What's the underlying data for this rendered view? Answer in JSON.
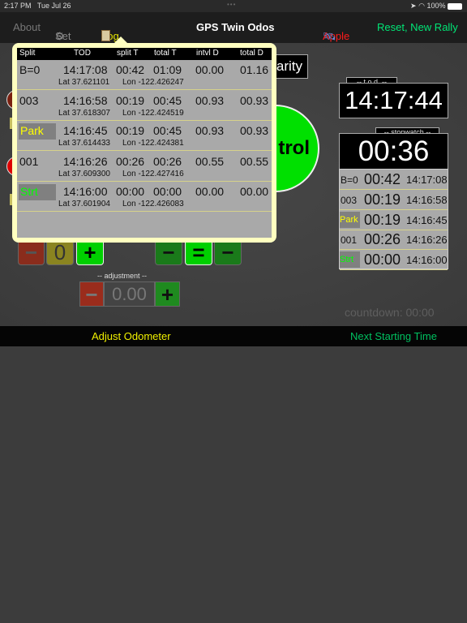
{
  "status_bar": {
    "time": "2:17 PM",
    "date": "Tue Jul 26",
    "battery": "100%"
  },
  "nav": {
    "about": "About",
    "settings": "Set",
    "log": "Log",
    "title": "GPS Twin Odos",
    "apple": "Apple",
    "reset": "Reset, New Rally"
  },
  "colors": {
    "log": "#e6e600",
    "apple": "#ff1a1a",
    "reset": "#00e676",
    "popover": "#ffffc0",
    "green_button": "#00e000"
  },
  "background": {
    "regularity_partial": "arity",
    "control_partial": "trol",
    "zero_button": "0",
    "adjustment_label": "-- adjustment --",
    "adjustment_value": "0.00",
    "minus": "−",
    "plus": "+",
    "equals": "="
  },
  "log": {
    "headers": [
      "Split",
      "TOD",
      "split T",
      "total T",
      "intvl D",
      "total D"
    ],
    "rows": [
      {
        "split": "B=0",
        "tod": "14:17:08",
        "split_t": "00:42",
        "total_t": "01:09",
        "intvl_d": "00.00",
        "total_d": "01.16",
        "lat": "Lat  37.621101",
        "lon": "Lon  -122.426247",
        "tag": ""
      },
      {
        "split": "003",
        "tod": "14:16:58",
        "split_t": "00:19",
        "total_t": "00:45",
        "intvl_d": "00.93",
        "total_d": "00.93",
        "lat": "Lat  37.618307",
        "lon": "Lon  -122.424519",
        "tag": ""
      },
      {
        "split": "Park",
        "tod": "14:16:45",
        "split_t": "00:19",
        "total_t": "00:45",
        "intvl_d": "00.93",
        "total_d": "00.93",
        "lat": "Lat  37.614433",
        "lon": "Lon  -122.424381",
        "tag": "#ffff00"
      },
      {
        "split": "001",
        "tod": "14:16:26",
        "split_t": "00:26",
        "total_t": "00:26",
        "intvl_d": "00.55",
        "total_d": "00.55",
        "lat": "Lat  37.609300",
        "lon": "Lon  -122.427416",
        "tag": ""
      },
      {
        "split": "Strt",
        "tod": "14:16:00",
        "split_t": "00:00",
        "total_t": "00:00",
        "intvl_d": "00.00",
        "total_d": "00.00",
        "lat": "Lat  37.601904",
        "lon": "Lon  -122.426083",
        "tag": "#00ff00"
      }
    ]
  },
  "tod": {
    "label": "-- t.o.d. --",
    "value": "14:17:44"
  },
  "stopwatch": {
    "label": "-- stopwatch --",
    "value": "00:36",
    "splits": [
      {
        "name": "B=0",
        "split": "00:42",
        "tod": "14:17:08",
        "tag": ""
      },
      {
        "name": "003",
        "split": "00:19",
        "tod": "14:16:58",
        "tag": ""
      },
      {
        "name": "Park",
        "split": "00:19",
        "tod": "14:16:45",
        "tag": "#ffff00"
      },
      {
        "name": "001",
        "split": "00:26",
        "tod": "14:16:26",
        "tag": ""
      },
      {
        "name": "Strt",
        "split": "00:00",
        "tod": "14:16:00",
        "tag": "#00ff00"
      }
    ]
  },
  "countdown": "countdown: 00:00",
  "bottom": {
    "adjust": "Adjust Odometer",
    "next": "Next Starting Time"
  }
}
